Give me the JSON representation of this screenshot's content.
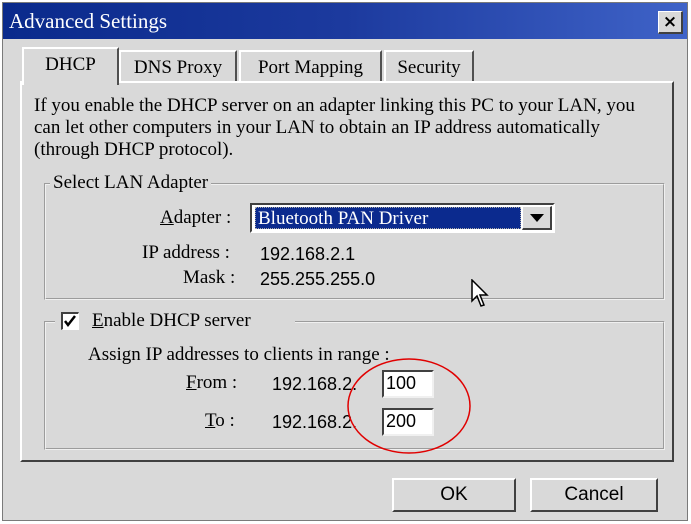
{
  "window": {
    "title": "Advanced Settings",
    "close_label": "×"
  },
  "tabs": [
    {
      "label": "DHCP",
      "active": true
    },
    {
      "label": "DNS Proxy",
      "active": false
    },
    {
      "label": "Port Mapping",
      "active": false
    },
    {
      "label": "Security",
      "active": false
    }
  ],
  "description": "If you enable the DHCP server on an adapter linking this PC to your LAN, you can let other computers in your LAN to obtain an IP address automatically (through DHCP protocol).",
  "lan_group": {
    "legend": "Select LAN Adapter",
    "adapter_label_mnemonic": "A",
    "adapter_label_rest": "dapter :",
    "adapter_value": "Bluetooth PAN Driver",
    "ip_label": "IP address :",
    "ip_value": "192.168.2.1",
    "mask_label": "Mask :",
    "mask_value": "255.255.255.0"
  },
  "dhcp_group": {
    "checkbox_checked": true,
    "enable_mnemonic": "E",
    "enable_rest": "nable DHCP server",
    "assign_text": "Assign IP addresses to clients in range :",
    "from_mnemonic": "F",
    "from_rest": "rom :",
    "from_prefix": "192.168.2.",
    "from_value": "100",
    "to_mnemonic": "T",
    "to_rest": "o :",
    "to_prefix": "192.168.2.",
    "to_value": "200"
  },
  "buttons": {
    "ok": "OK",
    "cancel": "Cancel"
  },
  "colors": {
    "title_bar": "#0a2a8c",
    "selection": "#0b2a8e",
    "annotation": "#e00000"
  }
}
